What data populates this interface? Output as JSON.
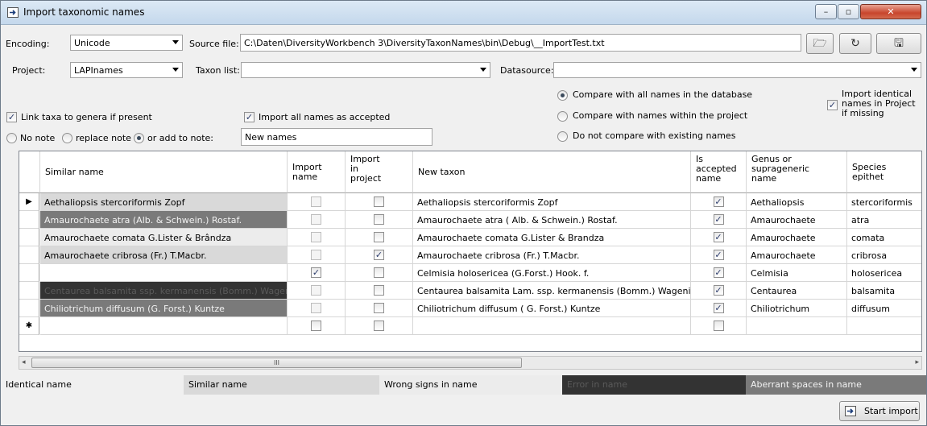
{
  "window": {
    "title": "Import taxonomic names",
    "min_glyph": "–",
    "max_glyph": "▫",
    "close_glyph": "✕"
  },
  "settings": {
    "encoding_label": "Encoding:",
    "encoding_value": "Unicode",
    "source_file_label": "Source file:",
    "source_file_value": "C:\\Daten\\DiversityWorkbench 3\\DiversityTaxonNames\\bin\\Debug\\__ImportTest.txt",
    "project_label": "Project:",
    "project_value": "LAPInames",
    "taxon_list_label": "Taxon list:",
    "taxon_list_value": "",
    "datasource_label": "Datasource:",
    "datasource_value": ""
  },
  "options": {
    "compare_all": "Compare with all names in the database",
    "compare_project": "Compare with names within the project",
    "no_compare": "Do not compare with existing names",
    "compare_selected": "compare_all",
    "import_identical_line1": "Import identical",
    "import_identical_line2": "names in Project",
    "import_identical_line3": "if missing",
    "import_identical_checked": true,
    "link_taxa": "Link taxa to genera if present",
    "link_taxa_checked": true,
    "import_accepted": "Import all names as accepted",
    "import_accepted_checked": true,
    "no_note": "No note",
    "replace_note": "replace note",
    "add_to_note": "or add to note:",
    "note_selected": "add_to_note",
    "note_value": "New names"
  },
  "grid": {
    "columns": {
      "similar_name": "Similar name",
      "import_name_1": "Import",
      "import_name_2": "name",
      "import_project_1": "Import",
      "import_project_2": "in",
      "import_project_3": "project",
      "new_taxon": "New taxon",
      "is_accepted_1": "Is",
      "is_accepted_2": "accepted",
      "is_accepted_3": "name",
      "genus_1": "Genus or",
      "genus_2": "suprageneric",
      "genus_3": "name",
      "species_1": "Species",
      "species_2": "epithet"
    },
    "rows": [
      {
        "marker": "▶",
        "similar": "Aethaliopsis stercoriformis Zopf",
        "status": "Similar name",
        "import_name": false,
        "import_project": false,
        "new_taxon": "Aethaliopsis stercoriformis Zopf",
        "accepted": true,
        "genus": "Aethaliopsis",
        "species": "stercoriformis"
      },
      {
        "marker": "",
        "similar": "Amaurochaete atra (Alb. & Schwein.) Rostaf.",
        "status": "Aberrant spaces in name",
        "import_name": false,
        "import_project": false,
        "new_taxon": "Amaurochaete atra ( Alb. & Schwein.) Rostaf.",
        "accepted": true,
        "genus": "Amaurochaete",
        "species": "atra"
      },
      {
        "marker": "",
        "similar": "Amaurochaete comata G.Lister & Brândza",
        "status": "Wrong signs in name",
        "import_name": false,
        "import_project": false,
        "new_taxon": "Amaurochaete comata G.Lister & Brandza",
        "accepted": true,
        "genus": "Amaurochaete",
        "species": "comata"
      },
      {
        "marker": "",
        "similar": "Amaurochaete cribrosa (Fr.) T.Macbr.",
        "status": "Similar name",
        "import_name": false,
        "import_project": true,
        "new_taxon": "Amaurochaete cribrosa (Fr.) T.Macbr.",
        "accepted": true,
        "genus": "Amaurochaete",
        "species": "cribrosa"
      },
      {
        "marker": "",
        "similar": "",
        "status": "",
        "import_name": true,
        "import_project": false,
        "new_taxon": "Celmisia holosericea (G.Forst.) Hook. f.",
        "accepted": true,
        "genus": "Celmisia",
        "species": "holosericea"
      },
      {
        "marker": "",
        "similar": "Centaurea balsamita ssp. kermanensis (Bomm.) Wagenitz",
        "status": "Error in name",
        "import_name": false,
        "import_project": false,
        "new_taxon": "Centaurea balsamita Lam. ssp. kermanensis (Bomm.) Wagenitz",
        "accepted": true,
        "genus": "Centaurea",
        "species": "balsamita"
      },
      {
        "marker": "",
        "similar": "Chiliotrichum diffusum (G. Forst.) Kuntze",
        "status": "Aberrant spaces in name",
        "import_name": false,
        "import_project": false,
        "new_taxon": "Chiliotrichum diffusum ( G. Forst.) Kuntze",
        "accepted": true,
        "genus": "Chiliotrichum",
        "species": "diffusum"
      },
      {
        "marker": "✱",
        "similar": "",
        "status": "",
        "import_name": false,
        "import_project": false,
        "new_taxon": "",
        "accepted": false,
        "genus": "",
        "species": ""
      }
    ]
  },
  "scroll": {
    "thumb_grip": "III",
    "left_arrow": "◂",
    "right_arrow": "▸"
  },
  "legend": {
    "identical": "Identical name",
    "similar": "Similar name",
    "wrong_signs": "Wrong signs in name",
    "error": "Error in name",
    "aberrant": "Aberrant spaces in name"
  },
  "colors": {
    "identical": "#f0f0f0",
    "similar": "#d9d9d9",
    "wrong_signs": "#ececec",
    "error": "#333333",
    "aberrant": "#7a7a7a"
  },
  "buttons": {
    "start_import": "Start import",
    "open_icon": "🗁",
    "refresh_icon": "↻",
    "save_icon": "🖫"
  }
}
